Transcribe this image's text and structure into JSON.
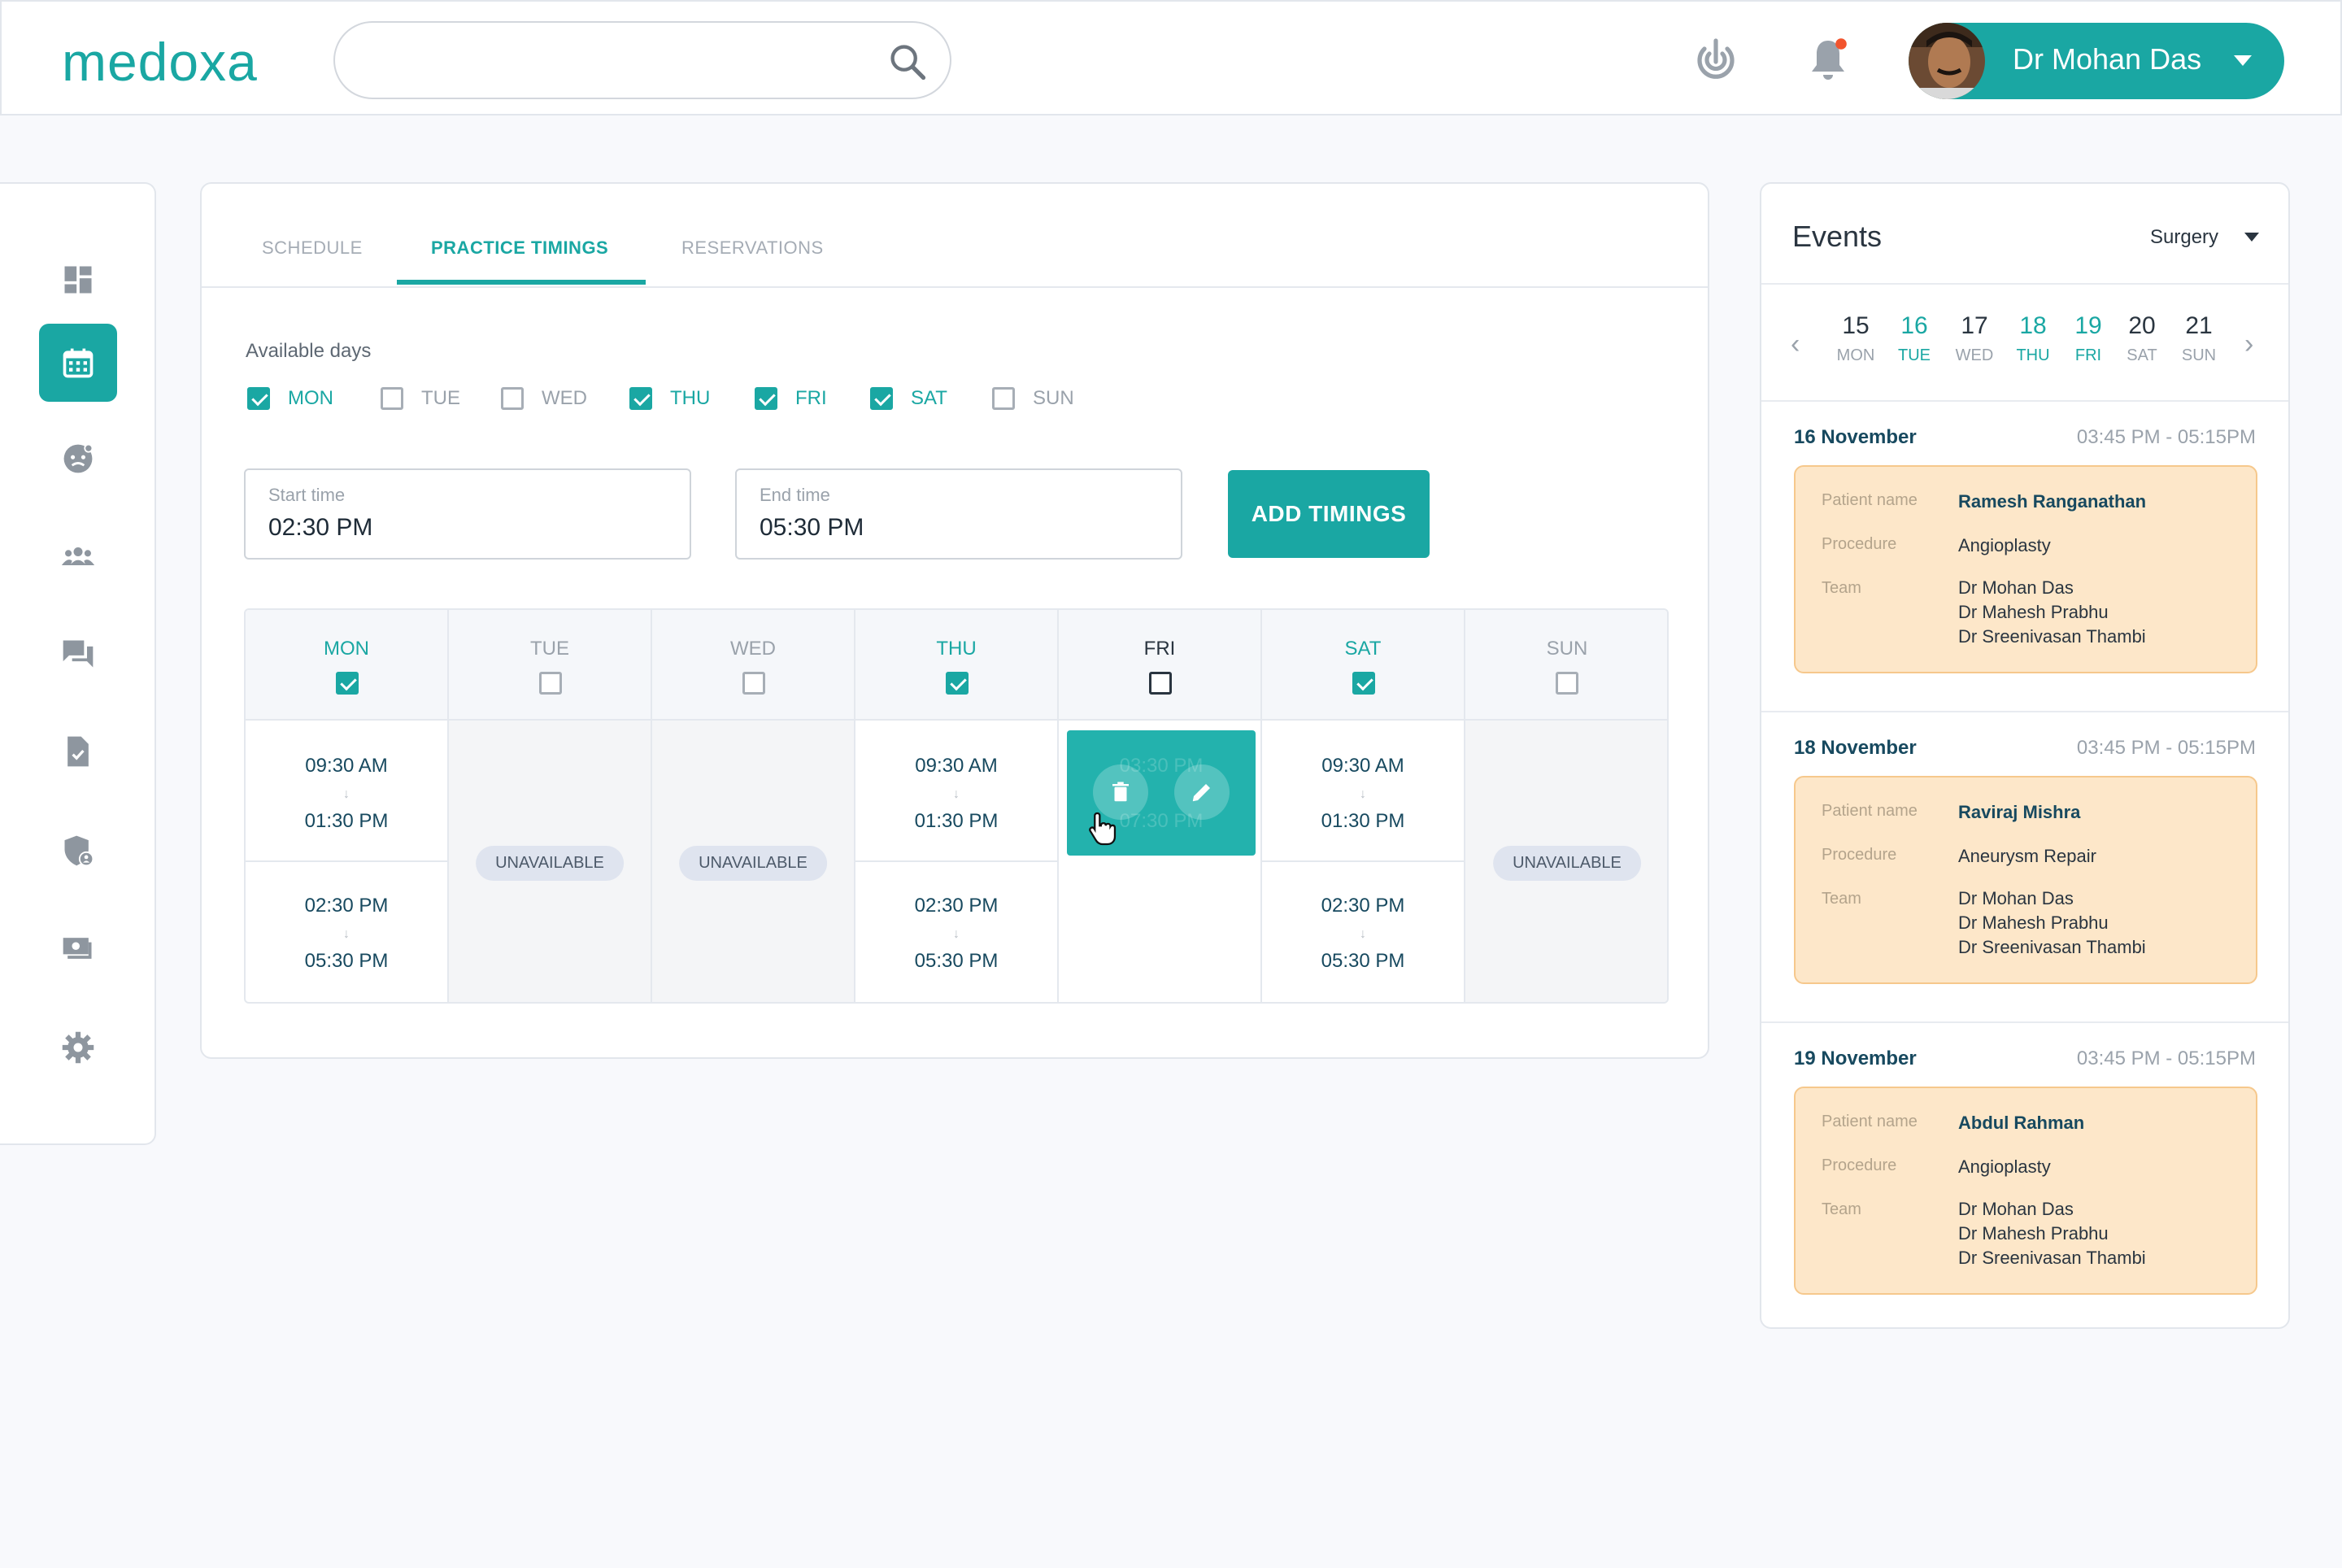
{
  "header": {
    "logo": "medoxa",
    "search": {
      "placeholder": "",
      "value": ""
    },
    "user_name": "Dr Mohan Das",
    "icons": [
      "search-icon",
      "activity-icon",
      "bell-icon",
      "avatar",
      "chevron-down-icon"
    ]
  },
  "sidebar": {
    "items": [
      {
        "name": "dashboard",
        "icon": "dashboard-icon",
        "active": false
      },
      {
        "name": "calendar",
        "icon": "calendar-icon",
        "active": true
      },
      {
        "name": "patients",
        "icon": "face-icon",
        "active": false
      },
      {
        "name": "team",
        "icon": "group-icon",
        "active": false
      },
      {
        "name": "messages",
        "icon": "chat-icon",
        "active": false
      },
      {
        "name": "reports",
        "icon": "document-check-icon",
        "active": false
      },
      {
        "name": "insurance",
        "icon": "shield-user-icon",
        "active": false
      },
      {
        "name": "billing",
        "icon": "money-icon",
        "active": false
      },
      {
        "name": "settings",
        "icon": "gear-icon",
        "active": false
      }
    ]
  },
  "tabs": [
    {
      "label": "SCHEDULE",
      "active": false
    },
    {
      "label": "PRACTICE TIMINGS",
      "active": true
    },
    {
      "label": "RESERVATIONS",
      "active": false
    }
  ],
  "available_days": {
    "label": "Available days",
    "days": [
      {
        "label": "MON",
        "checked": true
      },
      {
        "label": "TUE",
        "checked": false
      },
      {
        "label": "WED",
        "checked": false
      },
      {
        "label": "THU",
        "checked": true
      },
      {
        "label": "FRI",
        "checked": true
      },
      {
        "label": "SAT",
        "checked": true
      },
      {
        "label": "SUN",
        "checked": false
      }
    ]
  },
  "start_time": {
    "label": "Start time",
    "value": "02:30 PM"
  },
  "end_time": {
    "label": "End time",
    "value": "05:30 PM"
  },
  "add_button": "ADD TIMINGS",
  "grid": {
    "unavailable_label": "UNAVAILABLE",
    "arrow": "↓",
    "columns": [
      {
        "day": "MON",
        "checked": true,
        "slots": [
          [
            "09:30 AM",
            "01:30 PM"
          ],
          [
            "02:30 PM",
            "05:30 PM"
          ]
        ]
      },
      {
        "day": "TUE",
        "checked": false,
        "slots": []
      },
      {
        "day": "WED",
        "checked": false,
        "slots": []
      },
      {
        "day": "THU",
        "checked": true,
        "slots": [
          [
            "09:30 AM",
            "01:30 PM"
          ],
          [
            "02:30 PM",
            "05:30 PM"
          ]
        ]
      },
      {
        "day": "FRI",
        "checked": false,
        "slots": [
          [
            "03:30 PM",
            "07:30 PM"
          ]
        ]
      },
      {
        "day": "SAT",
        "checked": true,
        "slots": [
          [
            "09:30 AM",
            "01:30 PM"
          ],
          [
            "02:30 PM",
            "05:30 PM"
          ]
        ]
      },
      {
        "day": "SUN",
        "checked": false,
        "slots": []
      }
    ],
    "hover_actions": [
      "trash-icon",
      "pencil-icon"
    ]
  },
  "events": {
    "title": "Events",
    "filter": "Surgery",
    "calendar": [
      {
        "n": "15",
        "w": "MON",
        "highlight": false
      },
      {
        "n": "16",
        "w": "TUE",
        "highlight": true
      },
      {
        "n": "17",
        "w": "WED",
        "highlight": false
      },
      {
        "n": "18",
        "w": "THU",
        "highlight": true
      },
      {
        "n": "19",
        "w": "FRI",
        "highlight": true
      },
      {
        "n": "20",
        "w": "SAT",
        "highlight": false
      },
      {
        "n": "21",
        "w": "SUN",
        "highlight": false
      }
    ],
    "labels": {
      "patient": "Patient name",
      "procedure": "Procedure",
      "team": "Team"
    },
    "items": [
      {
        "date": "16 November",
        "time": "03:45 PM - 05:15PM",
        "patient": "Ramesh Ranganathan",
        "procedure": "Angioplasty",
        "team": [
          "Dr Mohan Das",
          "Dr Mahesh Prabhu",
          "Dr Sreenivasan Thambi"
        ]
      },
      {
        "date": "18 November",
        "time": "03:45 PM - 05:15PM",
        "patient": "Raviraj Mishra",
        "procedure": "Aneurysm Repair",
        "team": [
          "Dr Mohan Das",
          "Dr Mahesh Prabhu",
          "Dr Sreenivasan Thambi"
        ]
      },
      {
        "date": "19 November",
        "time": "03:45 PM - 05:15PM",
        "patient": "Abdul Rahman",
        "procedure": "Angioplasty",
        "team": [
          "Dr Mohan Das",
          "Dr Mahesh Prabhu",
          "Dr Sreenivasan Thambi"
        ]
      }
    ]
  },
  "colors": {
    "accent": "#1aa7a3",
    "event_card": "#fde7c9",
    "notification": "#f2542d"
  }
}
